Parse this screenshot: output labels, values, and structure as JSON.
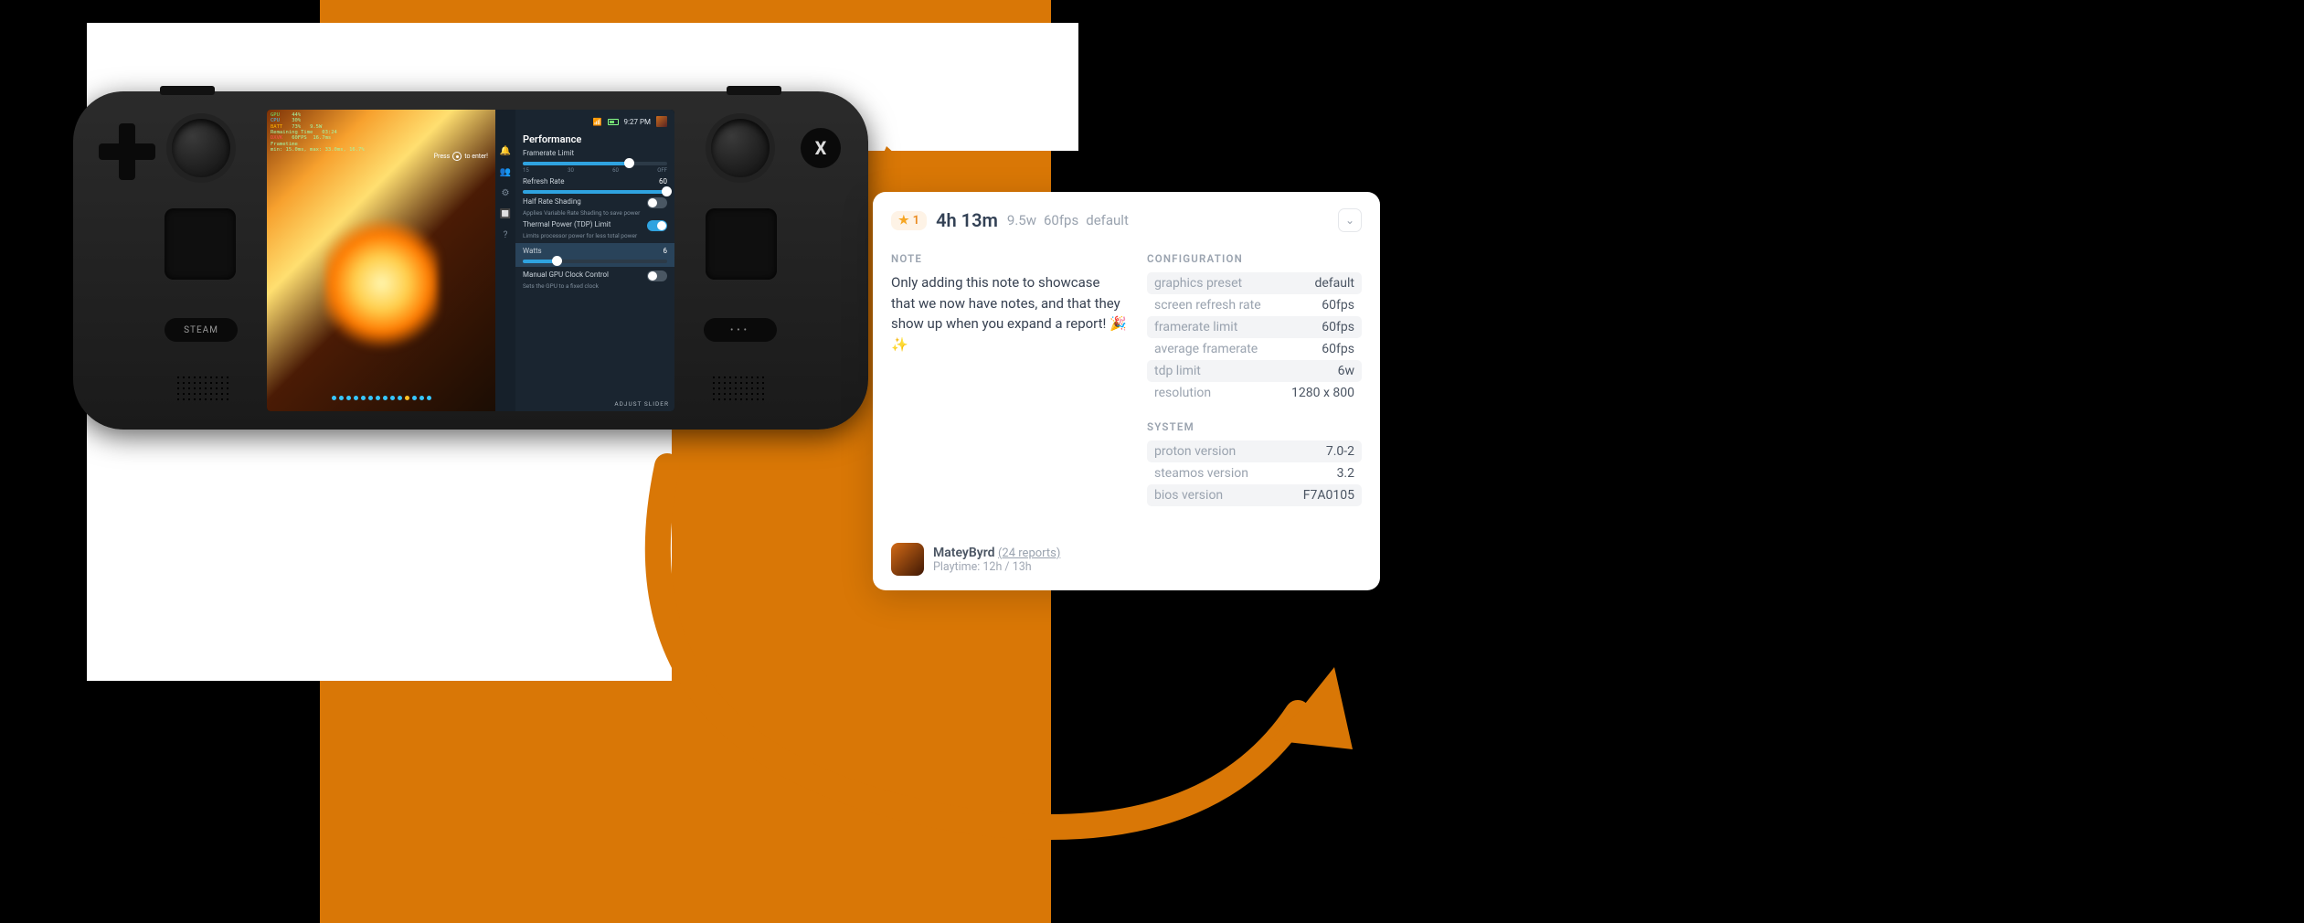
{
  "deck": {
    "steam_label": "STEAM",
    "menu_label": "•••",
    "btn_x": "X"
  },
  "osd": {
    "gpu_label": "GPU",
    "gpu_pct": "44%",
    "cpu_label": "CPU",
    "cpu_pct": "30%",
    "batt_label": "BATT",
    "batt_pct": "73%",
    "batt_w": "9.5W",
    "remain_label": "Remaining Time",
    "remain_time": "03:24",
    "dxvk_label": "DXVK",
    "fps": "60FPS",
    "ms": "16.7ms",
    "frametime_label": "Frametime",
    "ft_detail": "min: 15.0ms, max: 33.0ms, 16.7%"
  },
  "prompt": {
    "press": "Press",
    "toenter": "to enter!"
  },
  "qam": {
    "time": "9:27 PM",
    "title": "Performance",
    "framerate": {
      "label": "Framerate Limit",
      "ticks": [
        "15",
        "30",
        "60",
        "OFF"
      ]
    },
    "refresh": {
      "label": "Refresh Rate",
      "value": "60"
    },
    "hrs": {
      "label": "Half Rate Shading",
      "sub": "Applies Variable Rate Shading to save power"
    },
    "tdp": {
      "label": "Thermal Power (TDP) Limit",
      "sub": "Limits processor power for less total power"
    },
    "watts": {
      "label": "Watts",
      "value": "6"
    },
    "gpu": {
      "label": "Manual GPU Clock Control",
      "sub": "Sets the GPU to a fixed clock"
    },
    "footer": "ADJUST SLIDER"
  },
  "card": {
    "star": "1",
    "time": "4h 13m",
    "meta_w": "9.5w",
    "meta_fps": "60fps",
    "meta_preset": "default",
    "note_h": "NOTE",
    "note_text": "Only adding this note to showcase that we now have notes, and that they show up when you expand a report! 🎉✨",
    "cfg_h": "CONFIGURATION",
    "cfg": [
      {
        "k": "graphics preset",
        "v": "default"
      },
      {
        "k": "screen refresh rate",
        "v": "60fps"
      },
      {
        "k": "framerate limit",
        "v": "60fps"
      },
      {
        "k": "average framerate",
        "v": "60fps"
      },
      {
        "k": "tdp limit",
        "v": "6w"
      },
      {
        "k": "resolution",
        "v": "1280 x 800"
      }
    ],
    "sys_h": "SYSTEM",
    "sys": [
      {
        "k": "proton version",
        "v": "7.0-2"
      },
      {
        "k": "steamos version",
        "v": "3.2"
      },
      {
        "k": "bios version",
        "v": "F7A0105"
      }
    ],
    "user": {
      "name": "MateyByrd",
      "reports": "(24 reports)",
      "playtime": "Playtime: 12h / 13h"
    }
  }
}
